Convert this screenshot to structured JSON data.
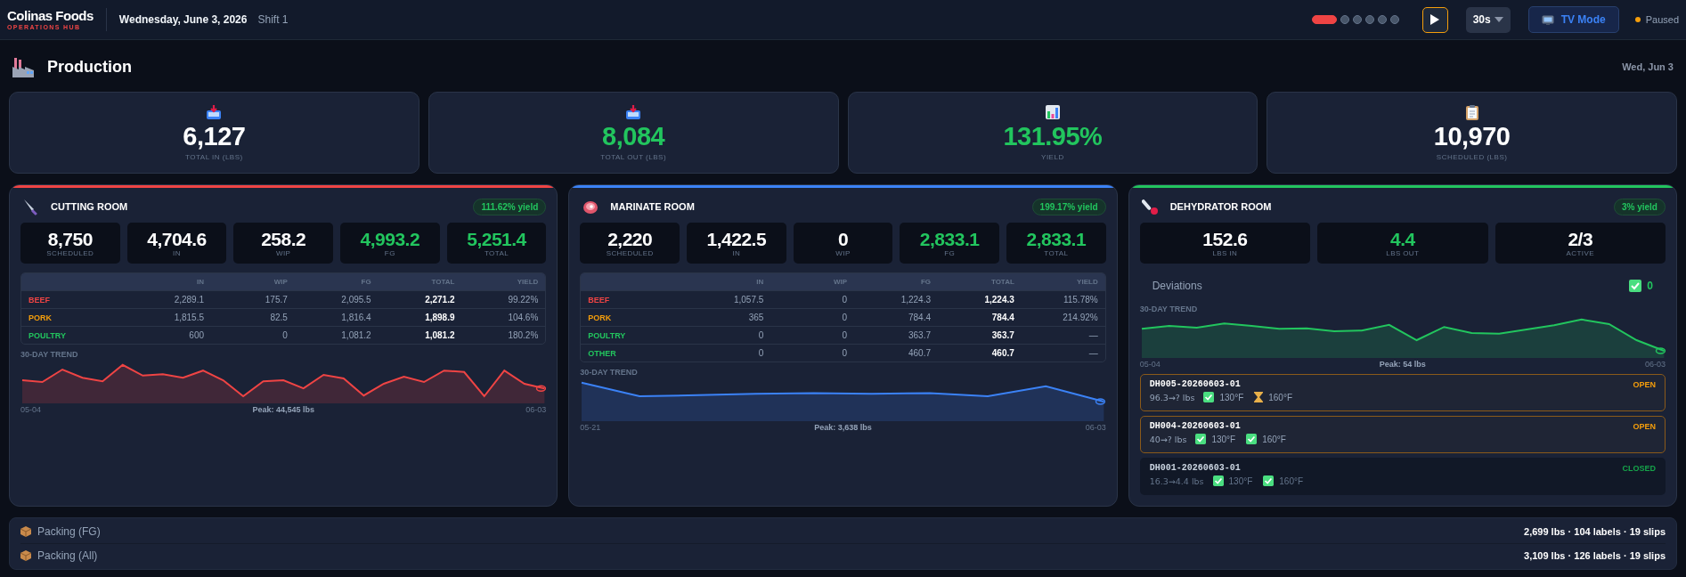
{
  "header": {
    "brand": "Colinas Foods",
    "subtitle": "OPERATIONS HUB",
    "date": "Wednesday, June 3, 2026",
    "shift": "Shift 1",
    "pages": [
      {
        "selected": true
      },
      {
        "selected": false
      },
      {
        "selected": false
      },
      {
        "selected": false
      },
      {
        "selected": false
      },
      {
        "selected": false
      }
    ],
    "interval": "30s",
    "tv_mode": "TV Mode",
    "status": "Paused"
  },
  "page": {
    "title": "Production",
    "date": "Wed, Jun 3"
  },
  "kpis": [
    {
      "kind": "in",
      "value": "6,127",
      "label": "TOTAL IN (LBS)",
      "positive": false
    },
    {
      "kind": "out",
      "value": "8,084",
      "label": "TOTAL OUT (LBS)",
      "positive": true
    },
    {
      "kind": "yield",
      "value": "131.95%",
      "label": "YIELD",
      "positive": true
    },
    {
      "kind": "scheduled",
      "value": "10,970",
      "label": "SCHEDULED (LBS)",
      "positive": false
    }
  ],
  "rooms": [
    {
      "kind": "production",
      "name": "CUTTING ROOM",
      "color": "#ef4444",
      "yield": "111.62% yield",
      "stats": [
        {
          "value": "8,750",
          "label": "SCHEDULED",
          "positive": false
        },
        {
          "value": "4,704.6",
          "label": "IN",
          "positive": false
        },
        {
          "value": "258.2",
          "label": "WIP",
          "positive": false
        },
        {
          "value": "4,993.2",
          "label": "FG",
          "positive": true
        },
        {
          "value": "5,251.4",
          "label": "TOTAL",
          "positive": true
        }
      ],
      "table": {
        "columns": [
          "IN",
          "WIP",
          "FG",
          "TOTAL",
          "YIELD"
        ],
        "rows": [
          {
            "name": "BEEF",
            "color": "#ef4444",
            "cells": [
              "2,289.1",
              "175.7",
              "2,095.5",
              "2,271.2",
              "99.22%"
            ]
          },
          {
            "name": "PORK",
            "color": "#f59e0b",
            "cells": [
              "1,815.5",
              "82.5",
              "1,816.4",
              "1,898.9",
              "104.6%"
            ]
          },
          {
            "name": "POULTRY",
            "color": "#22c55e",
            "cells": [
              "600",
              "0",
              "1,081.2",
              "1,081.2",
              "180.2%"
            ]
          }
        ]
      },
      "trend": {
        "label": "30-DAY TREND",
        "start": "05-04",
        "peak": "Peak: 44,545 lbs",
        "end": "06-03"
      }
    },
    {
      "kind": "production",
      "name": "MARINATE ROOM",
      "color": "#3b82f6",
      "yield": "199.17% yield",
      "stats": [
        {
          "value": "2,220",
          "label": "SCHEDULED",
          "positive": false
        },
        {
          "value": "1,422.5",
          "label": "IN",
          "positive": false
        },
        {
          "value": "0",
          "label": "WIP",
          "positive": false
        },
        {
          "value": "2,833.1",
          "label": "FG",
          "positive": true
        },
        {
          "value": "2,833.1",
          "label": "TOTAL",
          "positive": true
        }
      ],
      "table": {
        "columns": [
          "IN",
          "WIP",
          "FG",
          "TOTAL",
          "YIELD"
        ],
        "rows": [
          {
            "name": "BEEF",
            "color": "#ef4444",
            "cells": [
              "1,057.5",
              "0",
              "1,224.3",
              "1,224.3",
              "115.78%"
            ]
          },
          {
            "name": "PORK",
            "color": "#f59e0b",
            "cells": [
              "365",
              "0",
              "784.4",
              "784.4",
              "214.92%"
            ]
          },
          {
            "name": "POULTRY",
            "color": "#22c55e",
            "cells": [
              "0",
              "0",
              "363.7",
              "363.7",
              "—"
            ]
          },
          {
            "name": "OTHER",
            "color": "#22c55e",
            "cells": [
              "0",
              "0",
              "460.7",
              "460.7",
              "—"
            ]
          }
        ]
      },
      "trend": {
        "label": "30-DAY TREND",
        "start": "05-21",
        "peak": "Peak: 3,638 lbs",
        "end": "06-03"
      }
    },
    {
      "kind": "dehydrator",
      "name": "DEHYDRATOR ROOM",
      "color": "#22c55e",
      "yield": "3% yield",
      "stats": [
        {
          "value": "152.6",
          "label": "LBS IN",
          "positive": false
        },
        {
          "value": "4.4",
          "label": "LBS OUT",
          "positive": true
        },
        {
          "value": "2/3",
          "label": "ACTIVE",
          "positive": false
        }
      ],
      "deviations": {
        "label": "Deviations",
        "count": "0"
      },
      "trend": {
        "label": "30-DAY TREND",
        "start": "05-04",
        "peak": "Peak: 54 lbs",
        "end": "06-03"
      },
      "batches": [
        {
          "id": "DH005-20260603-01",
          "status": "OPEN",
          "closed": false,
          "weight": "96.3→? lbs",
          "checks": [
            {
              "label": "130°F",
              "done": true
            },
            {
              "label": "160°F",
              "done": false
            }
          ]
        },
        {
          "id": "DH004-20260603-01",
          "status": "OPEN",
          "closed": false,
          "weight": "40→? lbs",
          "checks": [
            {
              "label": "130°F",
              "done": true
            },
            {
              "label": "160°F",
              "done": true
            }
          ]
        },
        {
          "id": "DH001-20260603-01",
          "status": "CLOSED",
          "closed": true,
          "weight": "16.3→4.4 lbs",
          "checks": [
            {
              "label": "130°F",
              "done": true
            },
            {
              "label": "160°F",
              "done": true
            }
          ]
        }
      ]
    }
  ],
  "packing": [
    {
      "label": "Packing (FG)",
      "summary": "2,699 lbs · 104 labels · 19 slips"
    },
    {
      "label": "Packing (All)",
      "summary": "3,109 lbs · 126 labels · 19 slips"
    }
  ]
}
